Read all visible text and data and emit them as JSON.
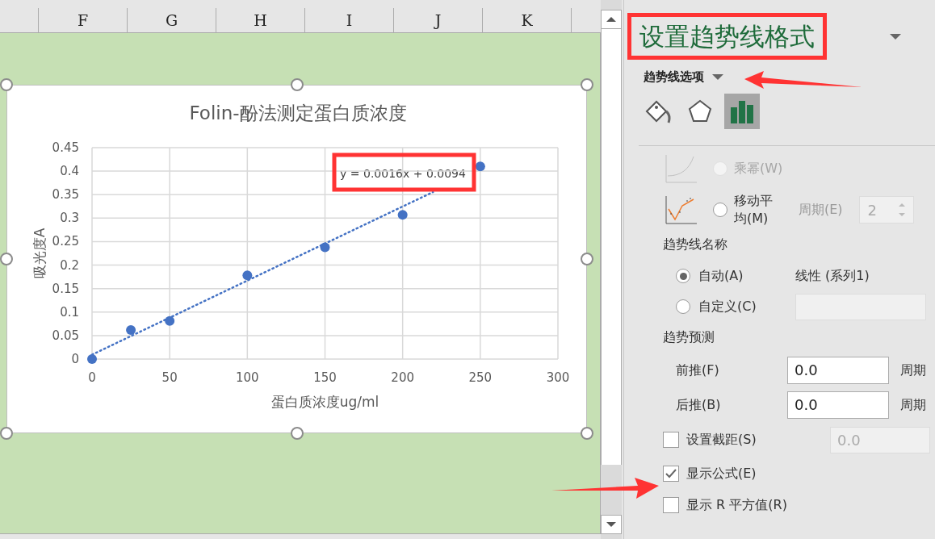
{
  "sheet": {
    "columns": [
      "F",
      "G",
      "H",
      "I",
      "J",
      "K"
    ],
    "chart_data": {
      "type": "scatter",
      "title": "Folin-酚法测定蛋白质浓度",
      "xlabel": "蛋白质浓度ug/ml",
      "ylabel": "吸光度A",
      "x": [
        0,
        25,
        50,
        100,
        150,
        200,
        250
      ],
      "series": [
        {
          "color": "#4472c4",
          "values": [
            0,
            0.062,
            0.081,
            0.178,
            0.238,
            0.307,
            0.41
          ]
        }
      ],
      "xlim": [
        0,
        300
      ],
      "ylim": [
        0,
        0.45
      ],
      "xticks": [
        0,
        50,
        100,
        150,
        200,
        250,
        300
      ],
      "yticks": [
        {
          "value": 0,
          "label": "0"
        },
        {
          "value": 0.05,
          "label": "0.05"
        },
        {
          "value": 0.1,
          "label": "0.1"
        },
        {
          "value": 0.15,
          "label": "0.15"
        },
        {
          "value": 0.2,
          "label": "0.2"
        },
        {
          "value": 0.25,
          "label": "0.25"
        },
        {
          "value": 0.3,
          "label": "0.3"
        },
        {
          "value": 0.35,
          "label": "0.35"
        },
        {
          "value": 0.4,
          "label": "0.4"
        },
        {
          "value": 0.45,
          "label": "0.45"
        }
      ],
      "grid": true,
      "annotations": [
        "y = 0.0016x + 0.0094"
      ]
    }
  },
  "panel": {
    "title": "设置趋势线格式",
    "section": "趋势线选项",
    "icon_tabs": [
      {
        "kind": "fill",
        "selected": false
      },
      {
        "kind": "effects",
        "selected": false
      },
      {
        "kind": "options",
        "selected": true
      }
    ],
    "trend_types": [
      {
        "kind": "power",
        "label": "乘幂(W)",
        "disabled": true,
        "selected": false
      },
      {
        "kind": "moving",
        "label": "移动平均(M)",
        "disabled": false,
        "selected": false,
        "period_label": "周期(E)",
        "period_value": "2"
      }
    ],
    "name_heading": "趋势线名称",
    "name_options": [
      {
        "label": "自动(A)",
        "selected": true,
        "value": "线性 (系列1)"
      },
      {
        "label": "自定义(C)",
        "selected": false
      }
    ],
    "forecast_heading": "趋势预测",
    "forecast": [
      {
        "label": "前推(F)",
        "value": "0.0",
        "unit": "周期"
      },
      {
        "label": "后推(B)",
        "value": "0.0",
        "unit": "周期"
      }
    ],
    "checkboxes": [
      {
        "label": "设置截距(S)",
        "checked": false,
        "value": "0.0"
      },
      {
        "label": "显示公式(E)",
        "checked": true
      },
      {
        "label": "显示 R 平方值(R)",
        "checked": false
      }
    ]
  }
}
